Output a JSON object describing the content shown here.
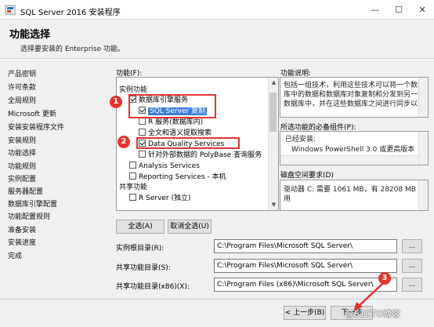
{
  "window": {
    "title": "SQL Server 2016 安装程序",
    "minimize": "—",
    "maximize": "☐",
    "close": "✕"
  },
  "header": {
    "title": "功能选择",
    "subtitle": "选择要安装的 Enterprise 功能。"
  },
  "nav": {
    "items": [
      "产品密钥",
      "许可条款",
      "全局规则",
      "Microsoft 更新",
      "安装安装程序文件",
      "安装规则",
      "功能选择",
      "功能规则",
      "实例配置",
      "服务器配置",
      "数据库引擎配置",
      "功能配置规则",
      "准备安装",
      "安装进度",
      "完成"
    ],
    "active_index": 6
  },
  "features": {
    "label": "功能(F):",
    "items": [
      {
        "text": "实例功能",
        "type": "group"
      },
      {
        "text": "数据库引擎服务",
        "checked": true,
        "level": 1
      },
      {
        "text": "SQL Server 复制",
        "checked": true,
        "level": 2,
        "selected": true
      },
      {
        "text": "R 服务(数据库内)",
        "checked": false,
        "level": 2
      },
      {
        "text": "全文和语义提取搜索",
        "checked": false,
        "level": 2
      },
      {
        "text": "Data Quality Services",
        "checked": true,
        "level": 2
      },
      {
        "text": "针对外部数据的 PolyBase 查询服务",
        "checked": false,
        "level": 2
      },
      {
        "text": "Analysis Services",
        "checked": false,
        "level": 1
      },
      {
        "text": "Reporting Services - 本机",
        "checked": false,
        "level": 1
      },
      {
        "text": "共享功能",
        "type": "group"
      },
      {
        "text": "R Server (独立)",
        "checked": false,
        "level": 1
      }
    ]
  },
  "description": {
    "label": "功能说明:",
    "text": [
      "包括一组技术，利用这些技术可以将一个数据",
      "库中的数据和数据库对象复制和分发到另一个",
      "数据库中，并在这些数据库之间进行同步以实"
    ]
  },
  "prerequisites": {
    "label": "所选功能的必备组件(P):",
    "installed_label": "已经安装:",
    "item": "Windows PowerShell 3.0 或更高版本"
  },
  "disk": {
    "label": "磁盘空间要求(D)",
    "text": [
      "驱动器 C: 需要 1061 MB，有 28208 MB 可",
      "用"
    ]
  },
  "buttons": {
    "select_all": "全选(A)",
    "deselect_all": "取消全选(U)",
    "back": "< 上一步(B)",
    "next": "下一步",
    "browse": "..."
  },
  "paths": {
    "instance_root_label": "实例根目录(R):",
    "instance_root": "C:\\Program Files\\Microsoft SQL Server\\",
    "shared_label": "共享功能目录(S):",
    "shared": "C:\\Program Files\\Microsoft SQL Server\\",
    "shared_x86_label": "共享功能目录(x86)(X):",
    "shared_x86": "C:\\Program Files (x86)\\Microsoft SQL Server\\"
  },
  "annotations": {
    "one": "1",
    "two": "2",
    "three": "3"
  },
  "watermark": "@51CTO博客",
  "colors": {
    "annotation_red": "#e53333",
    "selection_blue": "#3c7fd6"
  }
}
